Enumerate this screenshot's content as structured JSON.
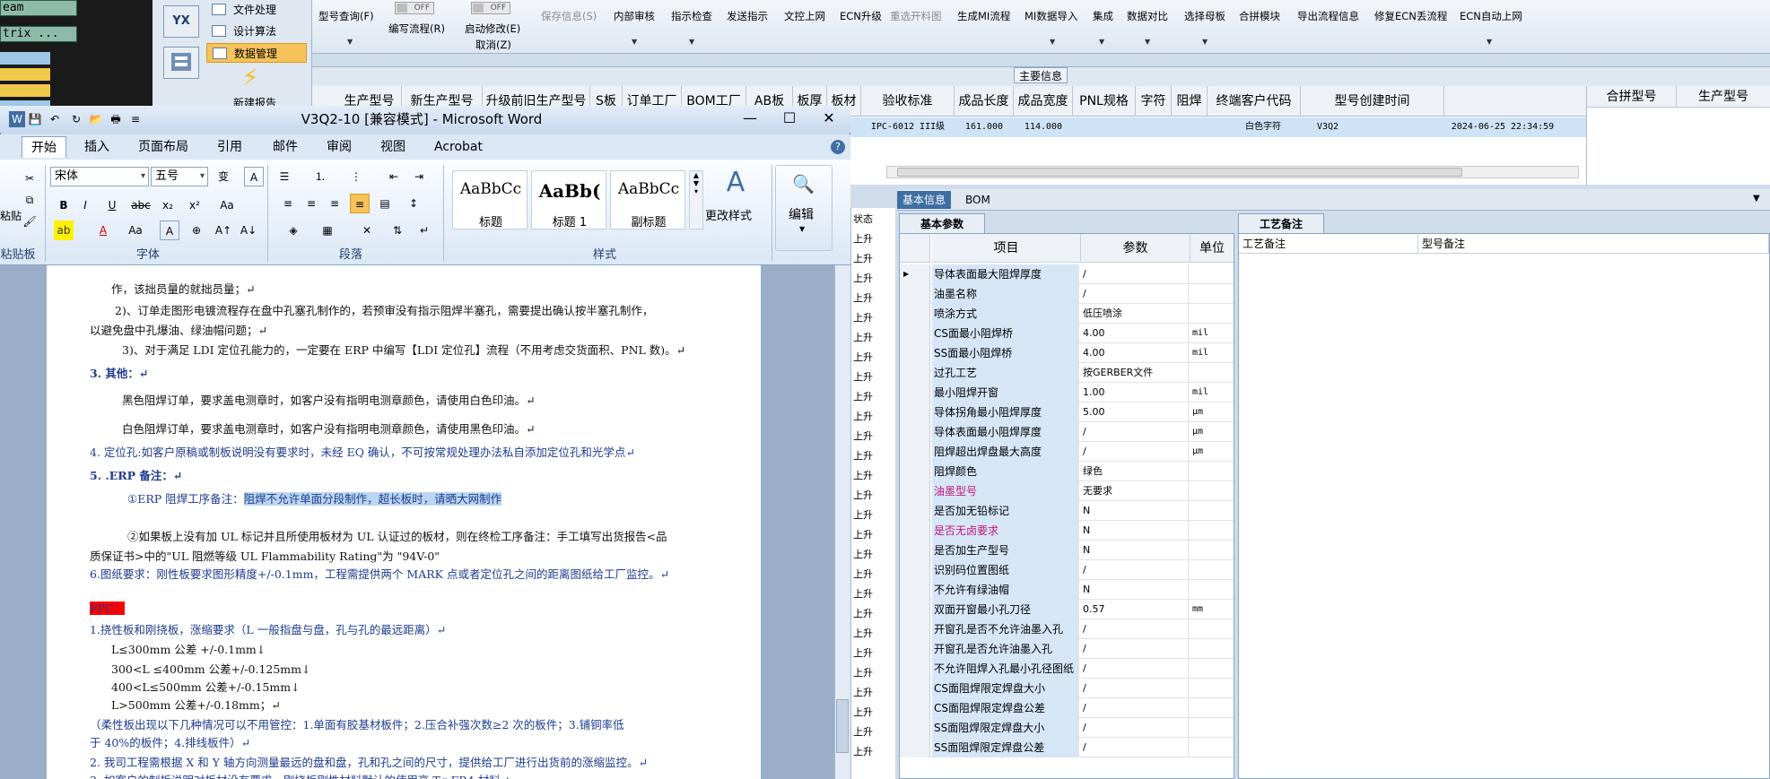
{
  "left_strip": {
    "items": [
      "eam",
      "trix ..."
    ]
  },
  "left_nav": {
    "items": [
      {
        "label": "文件处理"
      },
      {
        "label": "设计算法"
      },
      {
        "label": "数据管理"
      },
      {
        "label": "新建报告"
      }
    ],
    "big_icon_label": "YX"
  },
  "erp_toolbar": {
    "items": [
      {
        "label": "型号查询(F)"
      },
      {
        "label": "编写流程(R)"
      },
      {
        "label": "启动修改(E)"
      },
      {
        "label": "取消(Z)"
      },
      {
        "label": "保存信息(S)"
      },
      {
        "label": "内部审核"
      },
      {
        "label": "指示检查"
      },
      {
        "label": "发送指示"
      },
      {
        "label": "文控上网"
      },
      {
        "label": "ECN升级"
      },
      {
        "label": "重选开料图"
      },
      {
        "label": "生成MI流程"
      },
      {
        "label": "MI数据导入"
      },
      {
        "label": "集成"
      },
      {
        "label": "数据对比"
      },
      {
        "label": "选择母板"
      },
      {
        "label": "合拼模块"
      },
      {
        "label": "导出流程信息"
      },
      {
        "label": "修复ECN丢流程"
      },
      {
        "label": "ECN自动上网"
      }
    ],
    "toggle_off": "OFF"
  },
  "main_info": {
    "label": "主要信息"
  },
  "grid": {
    "headers": [
      "生产型号",
      "新生产型号",
      "升级前旧生产型号",
      "S板",
      "订单工厂",
      "BOM工厂",
      "AB板",
      "板厚",
      "板材",
      "验收标准",
      "成品长度",
      "成品宽度",
      "PNL规格",
      "字符",
      "阻焊",
      "终端客户代码",
      "型号创建时间"
    ],
    "row": {
      "standard": "IPC-6012 III级",
      "length": "161.000",
      "width": "114.000",
      "char": "白色字符",
      "client": "V3Q2",
      "created": "2024-06-25 22:34:59"
    },
    "merge_headers": [
      "合拼型号",
      "生产型号"
    ]
  },
  "bottom_tabs": {
    "active": "基本信息",
    "other": "BOM"
  },
  "basic_params": {
    "tab": "基本参数",
    "headers": {
      "item": "项目",
      "param": "参数",
      "unit": "单位"
    },
    "rows": [
      {
        "name": "导体表面最大阻焊厚度",
        "value": "/",
        "unit": ""
      },
      {
        "name": "油墨名称",
        "value": "/",
        "unit": ""
      },
      {
        "name": "喷涂方式",
        "value": "低压喷涂",
        "unit": ""
      },
      {
        "name": "CS面最小阻焊桥",
        "value": "4.00",
        "unit": "mil"
      },
      {
        "name": "SS面最小阻焊桥",
        "value": "4.00",
        "unit": "mil"
      },
      {
        "name": "过孔工艺",
        "value": "按GERBER文件",
        "unit": ""
      },
      {
        "name": "最小阻焊开窗",
        "value": "1.00",
        "unit": "mil"
      },
      {
        "name": "导体拐角最小阻焊厚度",
        "value": "5.00",
        "unit": "μm"
      },
      {
        "name": "导体表面最小阻焊厚度",
        "value": "/",
        "unit": "μm"
      },
      {
        "name": "阻焊超出焊盘最大高度",
        "value": "/",
        "unit": "μm"
      },
      {
        "name": "阻焊颜色",
        "value": "绿色",
        "unit": ""
      },
      {
        "name": "油墨型号",
        "value": "无要求",
        "unit": ""
      },
      {
        "name": "是否加无铅标记",
        "value": "N",
        "unit": ""
      },
      {
        "name": "是否无卤要求",
        "value": "N",
        "unit": ""
      },
      {
        "name": "是否加生产型号",
        "value": "N",
        "unit": ""
      },
      {
        "name": "识别码位置图纸",
        "value": "/",
        "unit": ""
      },
      {
        "name": "不允许有绿油帽",
        "value": "N",
        "unit": ""
      },
      {
        "name": "双面开窗最小孔刀径",
        "value": "0.57",
        "unit": "mm"
      },
      {
        "name": "开窗孔是否不允许油墨入孔",
        "value": "/",
        "unit": ""
      },
      {
        "name": "开窗孔是否允许油墨入孔",
        "value": "/",
        "unit": ""
      },
      {
        "name": "不允许阻焊入孔最小孔径图纸",
        "value": "/",
        "unit": ""
      },
      {
        "name": "CS面阻焊限定焊盘大小",
        "value": "/",
        "unit": ""
      },
      {
        "name": "CS面阻焊限定焊盘公差",
        "value": "/",
        "unit": ""
      },
      {
        "name": "SS面阻焊限定焊盘大小",
        "value": "/",
        "unit": ""
      },
      {
        "name": "SS面阻焊限定焊盘公差",
        "value": "/",
        "unit": ""
      }
    ]
  },
  "process_notes": {
    "tab": "工艺备注",
    "col1": "工艺备注",
    "col2": "型号备注"
  },
  "status_strip": {
    "header": "状态",
    "cell": "上升"
  },
  "word": {
    "title": "V3Q2-10 [兼容模式] - Microsoft Word",
    "tabs": [
      "开始",
      "插入",
      "页面布局",
      "引用",
      "邮件",
      "审阅",
      "视图",
      "Acrobat"
    ],
    "active_tab": "开始",
    "font_name": "宋体",
    "font_size": "五号",
    "groups": {
      "clipboard": "粘贴板",
      "font": "字体",
      "paragraph": "段落",
      "styles": "样式",
      "paste": "粘贴"
    },
    "styles": [
      {
        "sample": "AaBbCc",
        "name": "标题"
      },
      {
        "sample": "AaBb(",
        "name": "标题 1"
      },
      {
        "sample": "AaBbCc",
        "name": "副标题"
      }
    ],
    "change_styles": "更改样式",
    "edit": "编辑",
    "doc_lines": [
      "作，该拙员量的就拙员量；↵",
      "2)、订单走图形电镀流程存在盘中孔塞孔制作的，若预审没有指示阻焊半塞孔，需要提出确认按半塞孔制作，",
      "以避免盘中孔爆油、绿油帽问题；↵",
      "3)、对于满足 LDI 定位孔能力的，一定要在 ERP 中编写【LDI 定位孔】流程（不用考虑交货面积、PNL 数)。↵",
      "3. 其他：↵",
      "黑色阻焊订单，要求盖电测章时，如客户没有指明电测章颜色，请使用白色印油。↵",
      "白色阻焊订单，要求盖电测章时，如客户没有指明电测章颜色，请使用黑色印油。↵",
      "4. 定位孔:如客户原稿或制板说明没有要求时，未经 EQ 确认，不可按常规处理办法私自添加定位孔和光学点↵",
      "5. .ERP 备注：↵",
      "①ERP 阻焊工序备注：",
      "阻焊不允许单面分段制作，超长板时，请晒大网制作",
      "②如果板上没有加 UL 标记并且所使用板材为 UL 认证过的板材，则在终检工序备注：手工填写出货报告<品",
      "质保证书>中的\"UL 阻燃等级 UL Flammability Rating\"为 \"94V-0\"",
      "6.图纸要求：刚性板要求图形精度+/-0.1mm，工程需提供两个 MARK 点或者定位孔之间的距离图纸给工厂监控。↵",
      "FPC：",
      "1.挠性板和刚挠板，涨缩要求（L 一般指盘与盘，孔与孔的最远距离）↵",
      "L≤300mm 公差 +/-0.1mm↓",
      "300<L ≤400mm 公差+/-0.125mm↓",
      "400<L≤500mm 公差+/-0.15mm↓",
      "L>500mm 公差+/-0.18mm；↵",
      "（柔性板出现以下几种情况可以不用管控：1.单面有胶基材板件；2.压合补强次数≥2 次的板件；3.铺铜率低",
      "于 40%的板件；4.排线板件）↵",
      "2.  我司工程需根据 X 和 Y 轴方向测量最远的盘和盘，孔和孔之间的尺寸，提供给工厂进行出货前的涨缩监控。↵",
      "3. 如客户的制板说明对板材没有要求，刚挠板刚性材料默认的使用高 Tg FR4 材料↵"
    ]
  }
}
